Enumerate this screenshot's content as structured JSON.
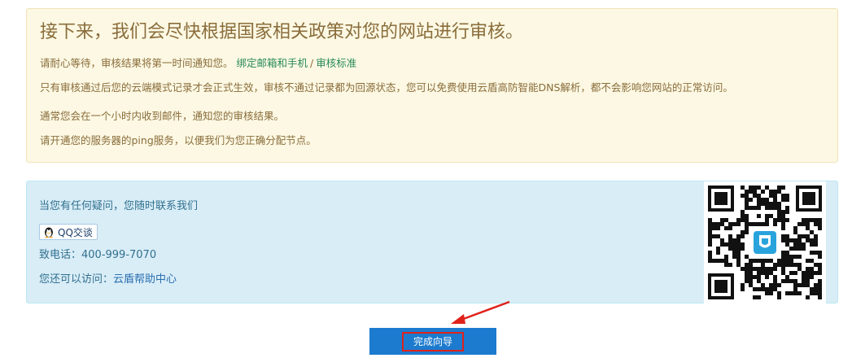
{
  "notice": {
    "title": "接下来，我们会尽快根据国家相关政策对您的网站进行审核。",
    "wait_text": "请耐心等待，审核结果将第一时间通知您。",
    "bind_link": "绑定邮箱和手机",
    "separator": "/",
    "standard_link": "审核标准",
    "line2": "只有审核通过后您的云端模式记录才会正式生效，审核不通过记录都为回源状态，您可以免费使用云盾高防智能DNS解析，都不会影响您网站的正常访问。",
    "line3": "通常您会在一个小时内收到邮件，通知您的审核结果。",
    "line4": "请开通您的服务器的ping服务，以便我们为您正确分配节点。"
  },
  "contact": {
    "intro": "当您有任何疑问，您随时联系我们",
    "qq_label": "QQ交谈",
    "phone": "致电话：400-999-7070",
    "visit_text": "您还可以访问：",
    "help_link": "云盾帮助中心"
  },
  "finish_button": {
    "label": "完成向导"
  },
  "colors": {
    "notice_bg": "#fcf8e3",
    "contact_bg": "#d9edf7",
    "button_bg": "#1c7bcf",
    "highlight_border": "#e0211b"
  }
}
